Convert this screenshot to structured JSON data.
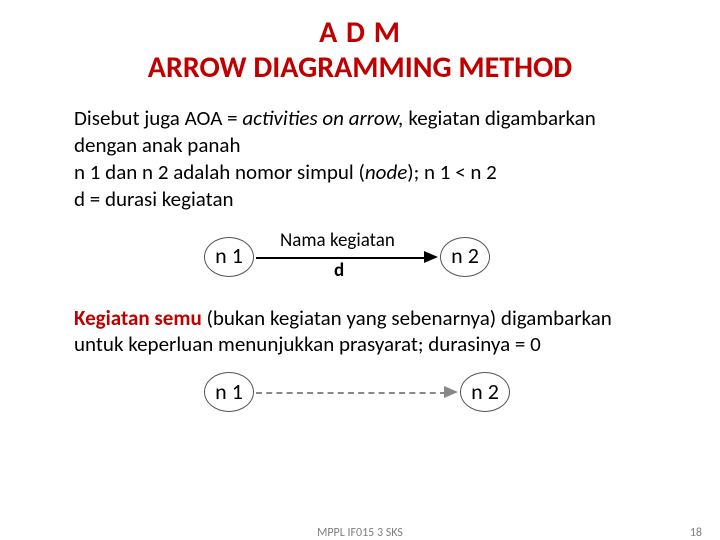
{
  "title": {
    "line1": "A D M",
    "line2": "ARROW DIAGRAMMING METHOD"
  },
  "p1a": "Disebut juga AOA  = ",
  "p1b": "activities on arrow,",
  "p1c": " kegiatan digambarkan dengan anak panah",
  "p2a": "n 1 dan n 2 adalah nomor simpul (",
  "p2b": "node",
  "p2c": "); n 1 < n 2",
  "p3": "d = durasi kegiatan",
  "diag1": {
    "left_node": "n 1",
    "right_node": "n 2",
    "top_label": "Nama  kegiatan",
    "bottom_label": "d"
  },
  "p4a": "Kegiatan semu",
  "p4b": " (bukan kegiatan yang sebenarnya) digambarkan untuk keperluan menunjukkan prasyarat; durasinya = 0",
  "diag2": {
    "left_node": "n 1",
    "right_node": "n 2"
  },
  "footer": {
    "center": "MPPL IF015    3 SKS",
    "page": "18"
  }
}
